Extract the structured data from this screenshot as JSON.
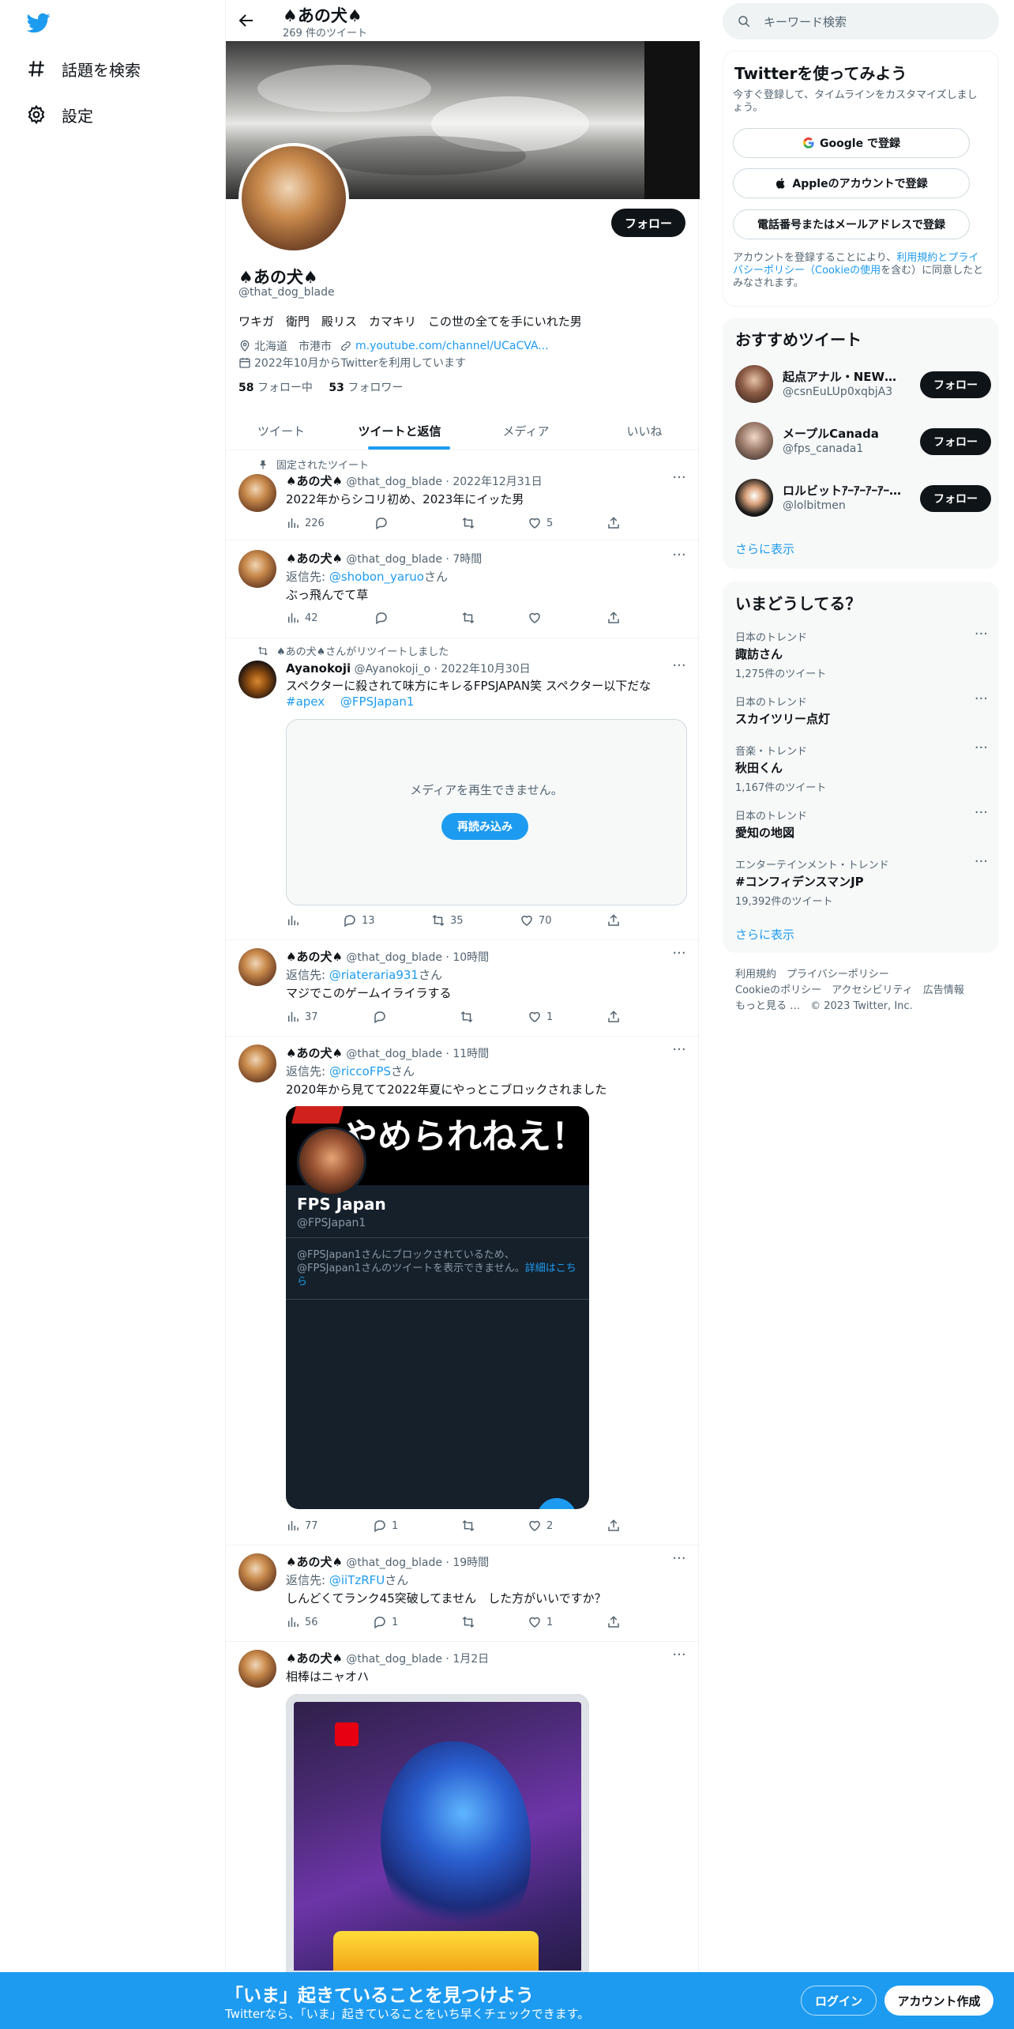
{
  "nav": {
    "explore_label": "話題を検索",
    "settings_label": "設定"
  },
  "profile": {
    "top_name": "♠あの犬♠",
    "tweet_count": "269 件のツイート",
    "follow_label": "フォロー",
    "name": "♠あの犬♠",
    "handle": "@that_dog_blade",
    "bio": "ワキガ　衛門　殿リス　カマキリ　この世の全てを手にいれた男",
    "location": "北海道　市港市",
    "link": "m.youtube.com/channel/UCaCVA...",
    "joined": "2022年10月からTwitterを利用しています",
    "following_count": "58",
    "following_label": "フォロー中",
    "followers_count": "53",
    "followers_label": "フォロワー"
  },
  "tabs": [
    {
      "label": "ツイート"
    },
    {
      "label": "ツイートと返信"
    },
    {
      "label": "メディア"
    },
    {
      "label": "いいね"
    }
  ],
  "tweets": [
    {
      "social": "固定されたツイート",
      "name": "♠あの犬♠",
      "handle": "@that_dog_blade",
      "time": "2022年12月31日",
      "text": "2022年からシコリ初め、2023年にイッた男",
      "views": "226",
      "replies": "",
      "retweets": "",
      "likes": "5"
    },
    {
      "name": "♠あの犬♠",
      "handle": "@that_dog_blade",
      "time": "7時間",
      "reply_prefix": "返信先: ",
      "reply_to": "@shobon_yaruo",
      "reply_suffix": "さん",
      "text": "ぶっ飛んでて草",
      "views": "42",
      "replies": "",
      "retweets": "",
      "likes": ""
    },
    {
      "social": "♠あの犬♠さんがリツイートしました",
      "name": "Ayanokoji",
      "handle": "@Ayanokoji_o",
      "time": "2022年10月30日",
      "text": "スペクターに殺されて味方にキレるFPSJAPAN笑 スペクター以下だな",
      "tag1": "#apex",
      "tag2": "@FPSJapan1",
      "media_msg": "メディアを再生できません。",
      "reload": "再読み込み",
      "views": "",
      "replies": "13",
      "retweets": "35",
      "likes": "70"
    },
    {
      "name": "♠あの犬♠",
      "handle": "@that_dog_blade",
      "time": "10時間",
      "reply_prefix": "返信先: ",
      "reply_to": "@riateraria931",
      "reply_suffix": "さん",
      "text": "マジでこのゲームイライラする",
      "views": "37",
      "replies": "",
      "retweets": "",
      "likes": "1"
    },
    {
      "name": "♠あの犬♠",
      "handle": "@that_dog_blade",
      "time": "11時間",
      "reply_prefix": "返信先: ",
      "reply_to": "@riccoFPS",
      "reply_suffix": "さん",
      "text": "2020年から見てて2022年夏にやっとこブロックされました",
      "views": "77",
      "replies": "1",
      "retweets": "",
      "likes": "2",
      "shot": {
        "banner": "やめられねえ！",
        "name": "FPS Japan",
        "handle": "@FPSJapan1",
        "block_text": "@FPSJapan1さんにブロックされているため、@FPSJapan1さんのツイートを表示できません。",
        "block_link": "詳細はこちら"
      }
    },
    {
      "name": "♠あの犬♠",
      "handle": "@that_dog_blade",
      "time": "19時間",
      "reply_prefix": "返信先: ",
      "reply_to": "@iiTzRFU",
      "reply_suffix": "さん",
      "text": "しんどくてランク45突破してません　した方がいいですか？",
      "views": "56",
      "replies": "1",
      "retweets": "",
      "likes": "1"
    },
    {
      "name": "♠あの犬♠",
      "handle": "@that_dog_blade",
      "time": "1月2日",
      "text": "相棒はニャオハ"
    }
  ],
  "right": {
    "search_placeholder": "キーワード検索",
    "signup": {
      "title": "Twitterを使ってみよう",
      "sub": "今すぐ登録して、タイムラインをカスタマイズしましょう。",
      "google": "Google で登録",
      "apple": "Appleのアカウントで登録",
      "phone": "電話番号またはメールアドレスで登録",
      "terms_pre": "アカウントを登録することにより、",
      "terms_link": "利用規約とプライバシーポリシー（Cookieの使用",
      "terms_post": "を含む）に同意したとみなされます。"
    },
    "recommend": {
      "title": "おすすめツイート",
      "items": [
        {
          "name": "起点アナル・NEWS…",
          "handle": "@csnEuLUp0xqbjA3",
          "button": "フォロー"
        },
        {
          "name": "メープルCanada",
          "handle": "@fps_canada1",
          "button": "フォロー"
        },
        {
          "name": "ロルビットｱｰｱｰｱｰｱｰ…",
          "handle": "@lolbitmen",
          "button": "フォロー"
        }
      ],
      "more": "さらに表示"
    },
    "trends": {
      "title": "いまどうしてる？",
      "items": [
        {
          "category": "日本のトレンド",
          "name": "諏訪さん",
          "count": "1,275件のツイート"
        },
        {
          "category": "日本のトレンド",
          "name": "スカイツリー点灯",
          "count": ""
        },
        {
          "category": "音楽・トレンド",
          "name": "秋田くん",
          "count": "1,167件のツイート"
        },
        {
          "category": "日本のトレンド",
          "name": "愛知の地図",
          "count": ""
        },
        {
          "category": "エンターテインメント・トレンド",
          "name": "#コンフィデンスマンJP",
          "count": "19,392件のツイート"
        }
      ],
      "more": "さらに表示"
    },
    "footer": {
      "line1": "利用規約　プライバシーポリシー",
      "line2": "Cookieのポリシー　アクセシビリティ　広告情報",
      "line3": "もっと見る …　© 2023 Twitter, Inc."
    }
  },
  "bottom": {
    "title": "「いま」起きていることを見つけよう",
    "sub": "Twitterなら、「いま」起きていることをいち早くチェックできます。",
    "login": "ログイン",
    "signup": "アカウント作成"
  },
  "colors": {
    "accent": "#1d9bf0",
    "text": "#0f1419",
    "secondary": "#536471"
  }
}
